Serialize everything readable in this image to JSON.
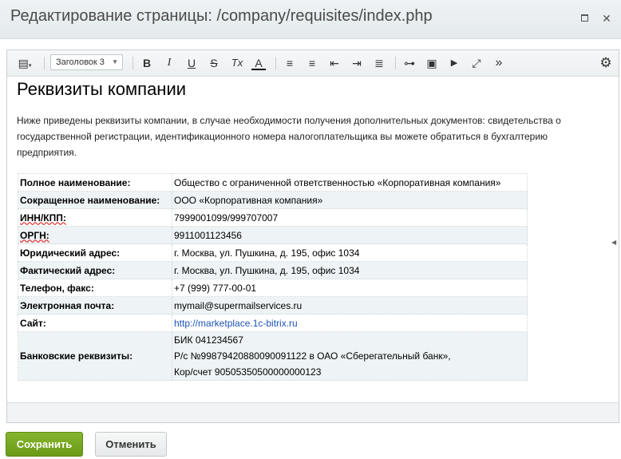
{
  "window": {
    "title": "Редактирование страницы: /company/requisites/index.php",
    "maximize_glyph": "□",
    "close_glyph": "✕"
  },
  "toolbar": {
    "view_mode_glyph": "▤",
    "style_select_value": "Заголовок 3",
    "bold": "B",
    "italic": "I",
    "underline": "U",
    "strike": "S",
    "clear_format": "Tx",
    "font_color": "A",
    "ordered_list": "≡",
    "unordered_list": "≡",
    "outdent": "⇤",
    "indent": "⇥",
    "align": "≣",
    "link": "⊶",
    "image": "▣",
    "video": "▶",
    "fullscreen": "⤢",
    "more": "»",
    "settings": "⚙"
  },
  "content": {
    "heading": "Реквизиты компании",
    "intro": "Ниже приведены реквизиты компании, в случае необходимости получения дополнительных документов: свидетельства о государственной регистрации, идентификационного номера налогоплательщика вы можете обратиться в бухгалтерию предприятия.",
    "rows": [
      {
        "label": "Полное наименование:",
        "value": "Общество с ограниченной ответственностью «Корпоративная компания»"
      },
      {
        "label": "Сокращенное наименование:",
        "value": "ООО «Корпоративная компания»"
      },
      {
        "label": "ИНН/КПП:",
        "value": "7999001099/999707007"
      },
      {
        "label": "ОРГН:",
        "value": "9911001123456"
      },
      {
        "label": "Юридический адрес:",
        "value": "г. Москва, ул. Пушкина, д. 195, офис 1034"
      },
      {
        "label": "Фактический адрес:",
        "value": "г. Москва, ул. Пушкина, д. 195, офис 1034"
      },
      {
        "label": "Телефон, факс:",
        "value": "+7 (999) 777-00-01"
      },
      {
        "label": "Электронная почта:",
        "value": "mymail@supermailservices.ru"
      },
      {
        "label": "Сайт:",
        "value": "http://marketplace.1c-bitrix.ru"
      }
    ],
    "bank": {
      "label": "Банковские реквизиты:",
      "line1": "БИК 041234567",
      "line2": "Р/с №99879420880090091122 в ОАО «Сберегательный банк»,",
      "line3": "Кор/счет 90505350500000000123"
    }
  },
  "buttons": {
    "save": "Сохранить",
    "cancel": "Отменить"
  },
  "colors": {
    "save_button": "#78a822",
    "link": "#1d54b5"
  }
}
